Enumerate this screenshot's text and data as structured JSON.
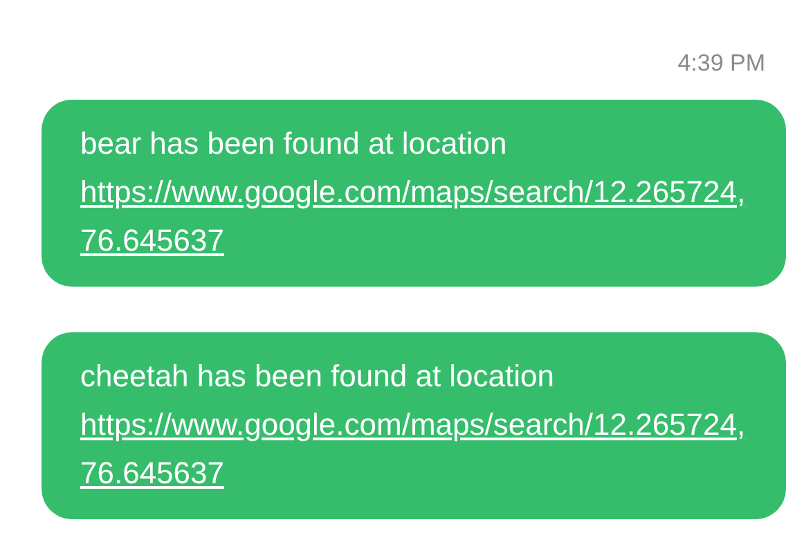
{
  "timestamp": "4:39 PM",
  "messages": [
    {
      "text": "bear has been found at location ",
      "link": "https://www.google.com/maps/search/12.265724,76.645637"
    },
    {
      "text": "cheetah has been found at location",
      "link": "https://www.google.com/maps/search/12.265724,76.645637"
    }
  ]
}
